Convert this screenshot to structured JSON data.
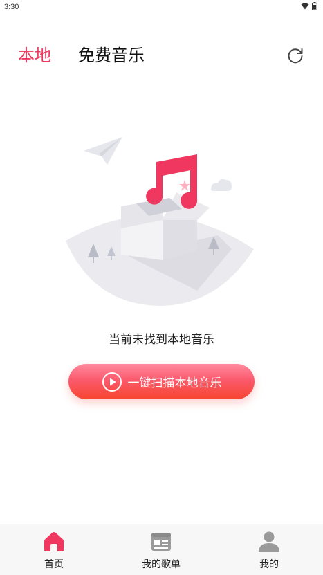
{
  "status_bar": {
    "time": "3:30"
  },
  "header": {
    "tabs": [
      {
        "label": "本地",
        "active": true
      },
      {
        "label": "免费音乐",
        "active": false
      }
    ],
    "refresh_icon": "refresh-icon"
  },
  "empty_state": {
    "illustration": "music-box-illustration",
    "message": "当前未找到本地音乐"
  },
  "scan_button": {
    "label": "一键扫描本地音乐",
    "icon": "play-circle-icon"
  },
  "bottom_nav": {
    "items": [
      {
        "label": "首页",
        "icon": "home-icon",
        "active": true
      },
      {
        "label": "我的歌单",
        "icon": "playlist-icon",
        "active": false
      },
      {
        "label": "我的",
        "icon": "user-icon",
        "active": false
      }
    ]
  },
  "colors": {
    "accent": "#f0375f",
    "button_gradient_top": "#ff8a9e",
    "button_gradient_bottom": "#f7452f",
    "nav_inactive": "#9a9a9a"
  }
}
